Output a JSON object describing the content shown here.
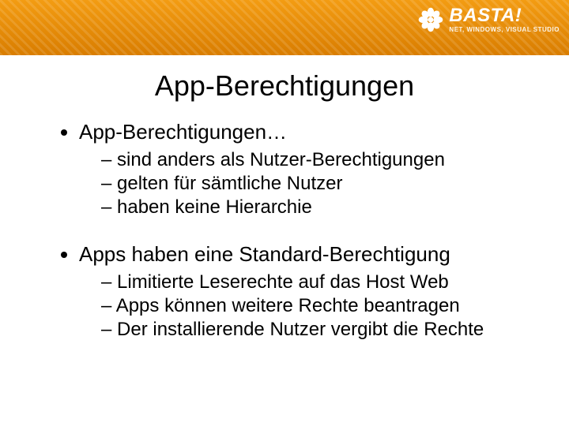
{
  "brand": {
    "title": "BASTA!",
    "subtitle": "NET, WINDOWS, VISUAL STUDIO"
  },
  "slide": {
    "title": "App-Berechtigungen",
    "bullets": [
      {
        "text": "App-Berechtigungen…",
        "sub": [
          "sind anders als Nutzer-Berechtigungen",
          "gelten für sämtliche Nutzer",
          "haben keine Hierarchie"
        ]
      },
      {
        "text": "Apps haben eine Standard-Berechtigung",
        "sub": [
          "Limitierte Leserechte auf das Host Web",
          "Apps können weitere Rechte beantragen",
          "Der installierende Nutzer vergibt die Rechte"
        ]
      }
    ]
  }
}
